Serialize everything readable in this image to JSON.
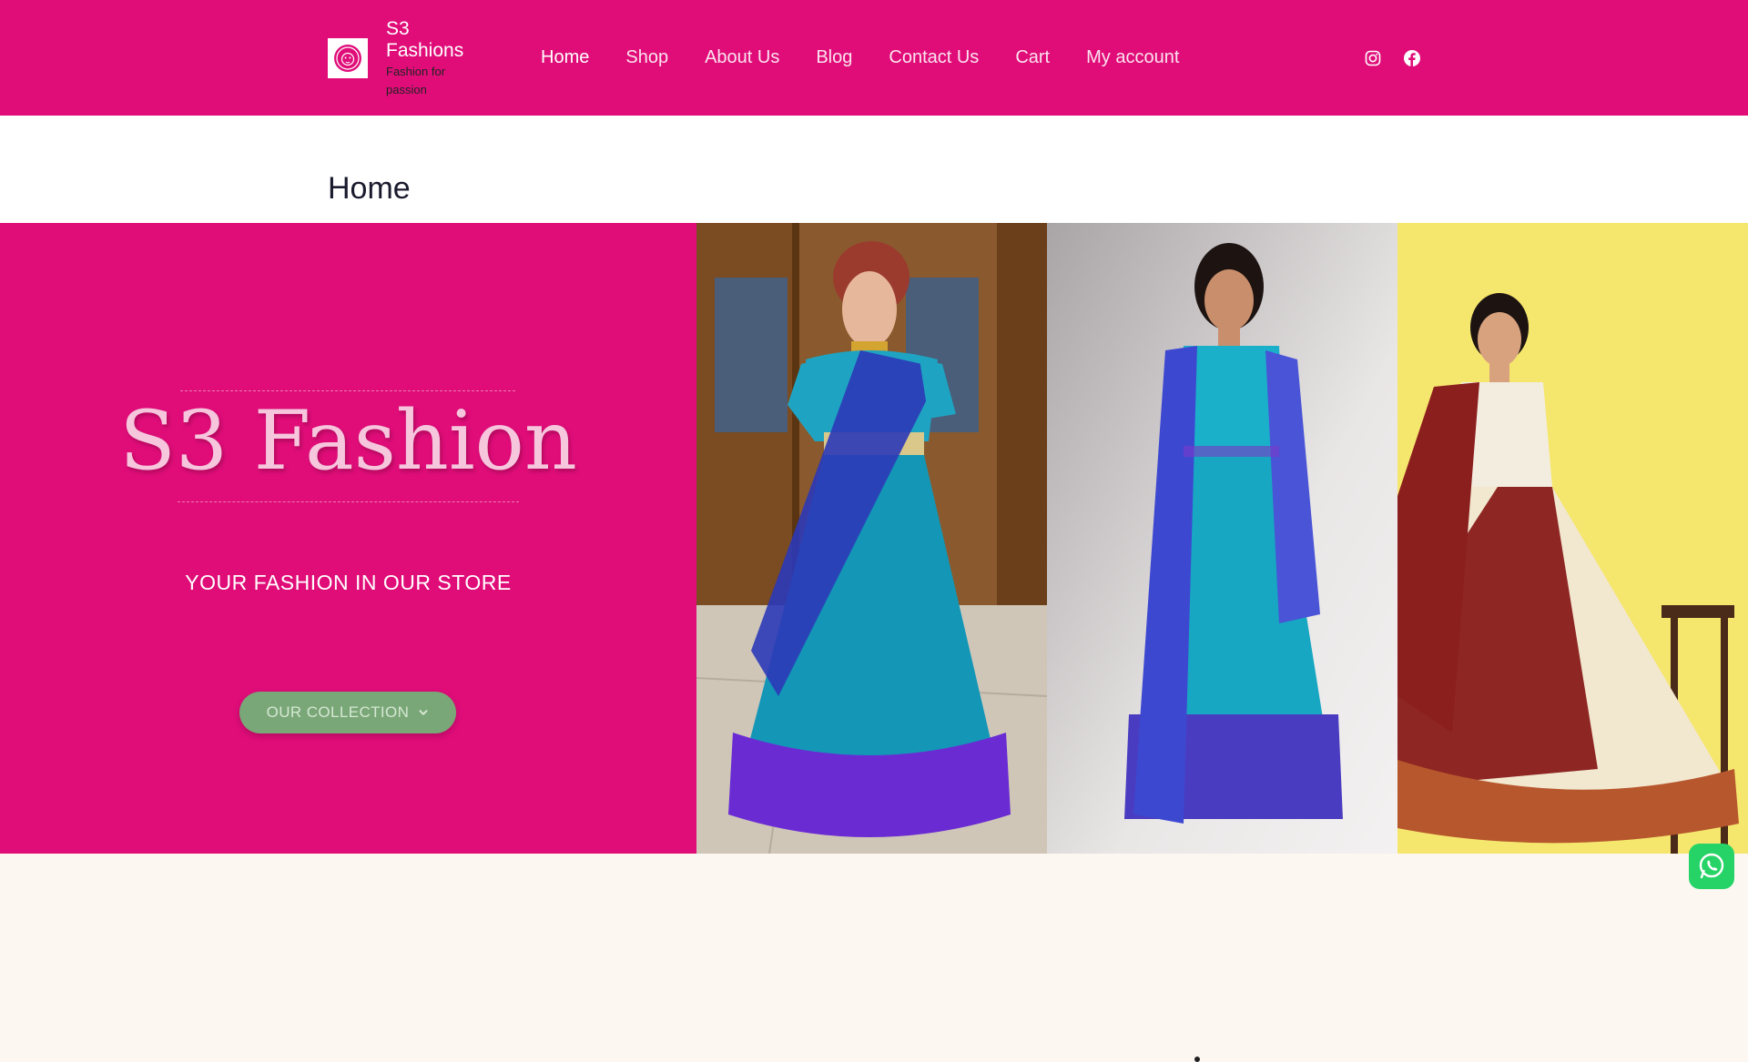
{
  "header": {
    "site_title": "S3 Fashions",
    "tagline": "Fashion for passion",
    "nav": [
      "Home",
      "Shop",
      "About Us",
      "Blog",
      "Contact Us",
      "Cart",
      "My account"
    ],
    "active_nav": "Home",
    "social_icons": [
      "instagram-icon",
      "facebook-icon"
    ]
  },
  "page": {
    "title": "Home"
  },
  "hero": {
    "brand": "S3 Fashion",
    "tagline": "YOUR FASHION IN OUR STORE",
    "button_label": "OUR COLLECTION",
    "button_icon": "chevron-down-icon"
  },
  "colors": {
    "brand_pink": "#e00d79",
    "button_green": "#7aa777",
    "page_bg": "#fdf7f2"
  },
  "floating": {
    "chat_icon": "whatsapp-icon"
  }
}
